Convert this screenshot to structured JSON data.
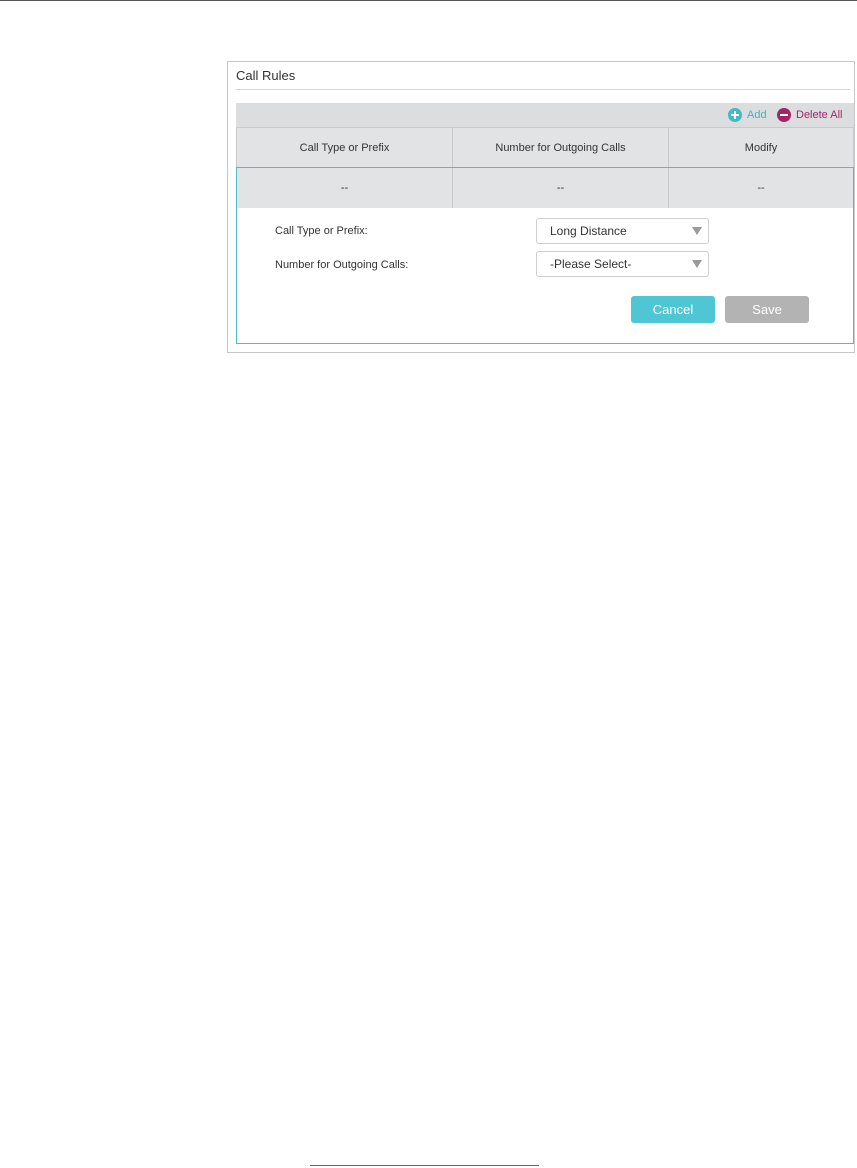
{
  "panel": {
    "title": "Call Rules",
    "toolbar": {
      "add_label": "Add",
      "delete_all_label": "Delete All"
    },
    "table": {
      "columns": [
        "Call Type or Prefix",
        "Number for Outgoing Calls",
        "Modify"
      ],
      "rows": [
        [
          "--",
          "--",
          "--"
        ]
      ]
    },
    "form": {
      "call_type_label": "Call Type or Prefix:",
      "call_type_value": "Long Distance",
      "number_label": "Number for Outgoing Calls:",
      "number_value": "-Please Select-",
      "cancel_label": "Cancel",
      "save_label": "Save"
    }
  },
  "colors": {
    "accent": "#4ec6d4",
    "delete": "#a32566",
    "save_disabled": "#b3b3b3"
  }
}
